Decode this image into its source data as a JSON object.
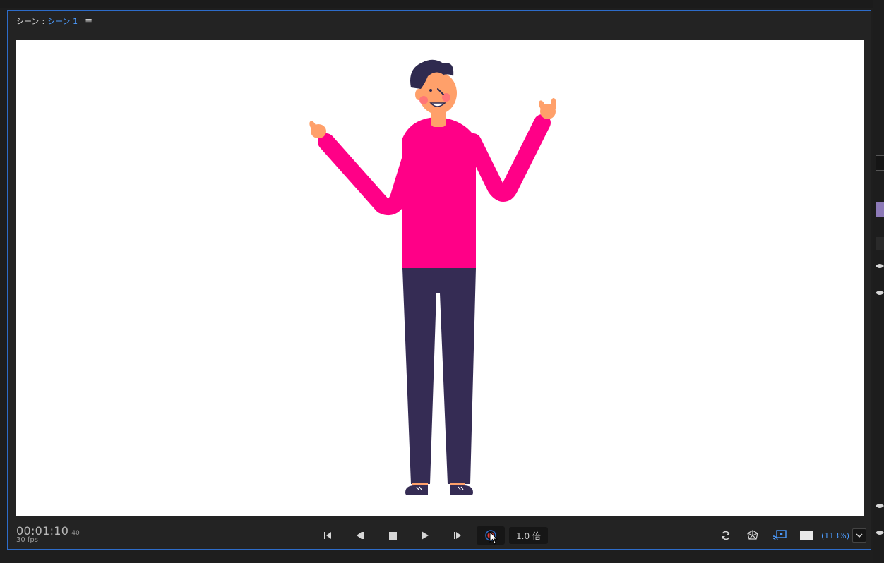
{
  "panel": {
    "label": "シーン",
    "separator": ":",
    "scene_name": "シーン 1",
    "menu_icon": "hamburger-menu-icon"
  },
  "timecode": {
    "main": "00:01:10",
    "frame": "40",
    "fps": "30 fps"
  },
  "transport": {
    "buttons": [
      "jump-to-start-icon",
      "step-back-icon",
      "stop-icon",
      "play-icon",
      "step-forward-icon",
      "record-icon"
    ],
    "speed": "1.0 倍"
  },
  "right_tools": {
    "icons": [
      "refresh-icon",
      "mesh-icon",
      "cast-icon",
      "background-swatch-icon"
    ],
    "zoom": "(113%)"
  },
  "colors": {
    "accent": "#2d6cc9",
    "scene_link": "#4c9cff",
    "shirt": "#ff0087",
    "pants": "#352c54",
    "skin": "#ffa06a",
    "hair": "#2f2a4f"
  }
}
